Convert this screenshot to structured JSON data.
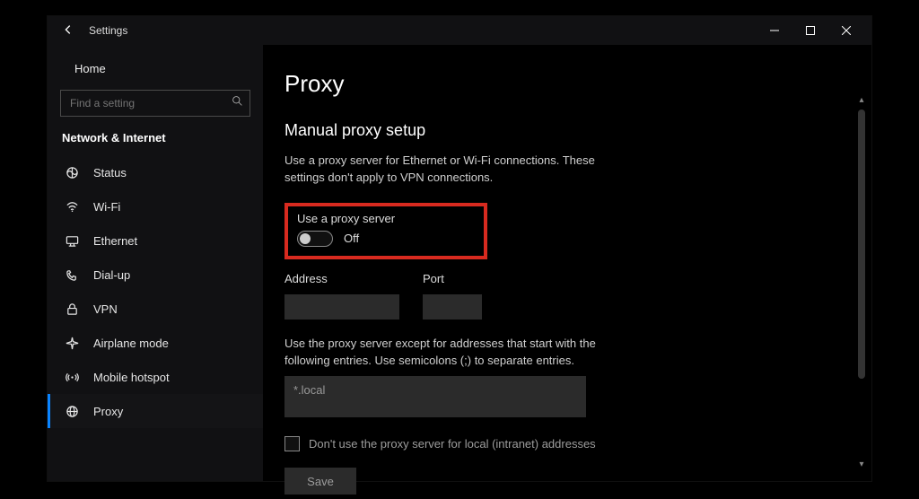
{
  "window": {
    "title": "Settings"
  },
  "sidebar": {
    "home_label": "Home",
    "search_placeholder": "Find a setting",
    "section_title": "Network & Internet",
    "items": [
      {
        "label": "Status",
        "icon": "status-icon"
      },
      {
        "label": "Wi-Fi",
        "icon": "wifi-icon"
      },
      {
        "label": "Ethernet",
        "icon": "ethernet-icon"
      },
      {
        "label": "Dial-up",
        "icon": "dialup-icon"
      },
      {
        "label": "VPN",
        "icon": "vpn-icon"
      },
      {
        "label": "Airplane mode",
        "icon": "airplane-icon"
      },
      {
        "label": "Mobile hotspot",
        "icon": "hotspot-icon"
      },
      {
        "label": "Proxy",
        "icon": "proxy-icon"
      }
    ]
  },
  "page": {
    "title": "Proxy",
    "section_title": "Manual proxy setup",
    "description": "Use a proxy server for Ethernet or Wi-Fi connections. These settings don't apply to VPN connections.",
    "toggle_label": "Use a proxy server",
    "toggle_state": "Off",
    "address_label": "Address",
    "address_value": "",
    "port_label": "Port",
    "port_value": "",
    "exceptions_label": "Use the proxy server except for addresses that start with the following entries. Use semicolons (;) to separate entries.",
    "exceptions_value": "*.local",
    "local_bypass_label": "Don't use the proxy server for local (intranet) addresses",
    "local_bypass_checked": false,
    "save_label": "Save"
  }
}
